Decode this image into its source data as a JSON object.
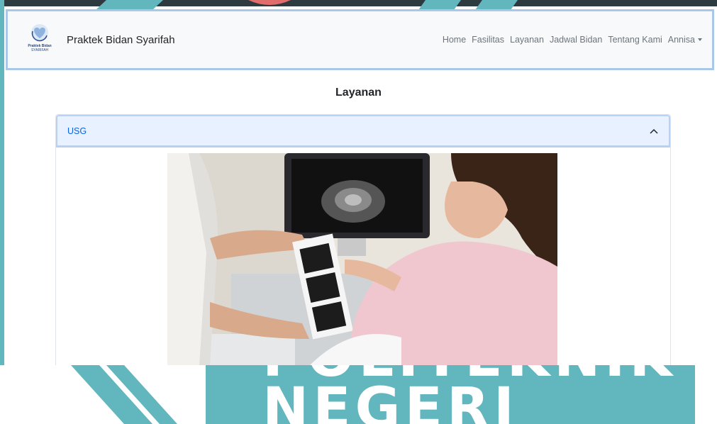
{
  "navbar": {
    "logo_text": "Praktek Bidan",
    "logo_subtext": "SYARIFAH",
    "brand": "Praktek Bidan Syarifah",
    "links": [
      "Home",
      "Fasilitas",
      "Layanan",
      "Jadwal Bidan",
      "Tentang Kami"
    ],
    "user_menu": "Annisa"
  },
  "page": {
    "title": "Layanan"
  },
  "accordion": {
    "item_title": "USG",
    "expanded": true
  },
  "watermark": {
    "line1": "POLITEKNIK",
    "line2": "NEGERI"
  },
  "colors": {
    "navbar_border": "#a9c8e8",
    "accordion_active_bg": "#e7f1ff",
    "accordion_active_text": "#0c63e4",
    "watermark": "#62b6bd"
  }
}
